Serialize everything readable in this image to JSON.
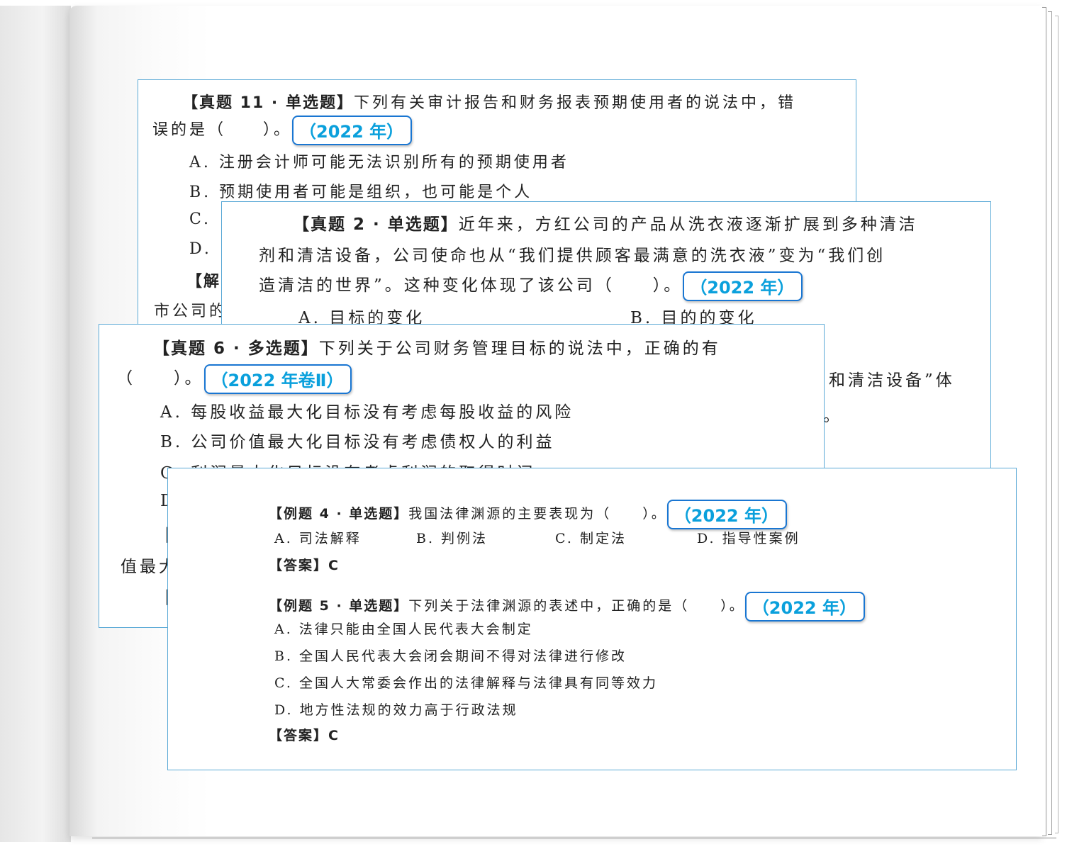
{
  "card1": {
    "question_header": "【真题 11 · 单选题】",
    "question_text_1": "下列有关审计报告和财务报表预期使用者的说法中，错",
    "question_text_2": "误的是（　　）。",
    "year_tag": "（2022 年）",
    "option_a": "A. 注册会计师可能无法识别所有的预期使用者",
    "option_b": "B. 预期使用者可能是组织，也可能是个人",
    "option_c_visible": "C. ",
    "option_d_visible": "D. ",
    "analysis_visible": "【解",
    "partial_line": "市公司的"
  },
  "card2": {
    "question_header": "【真题 2 · 单选题】",
    "question_text_1": "近年来，方红公司的产品从洗衣液逐渐扩展到多种清洁",
    "question_text_2": "剂和清洁设备，公司使命也从“我们提供顾客最满意的洗衣液”变为“我们创",
    "question_text_3": "造清洁的世界”。这种变化体现了该公司（　　）。",
    "year_tag": "（2022 年）",
    "option_a": "A. 目标的变化",
    "option_b": "B. 目的的变化",
    "partial_right_text": "和清洁设备”体",
    "partial_right_mark": "。"
  },
  "card3": {
    "question_header": "【真题 6 · 多选题】",
    "question_text_1": "下列关于公司财务管理目标的说法中，正确的有",
    "question_text_2": "（　　）。",
    "year_tag": "（2022 年卷Ⅱ）",
    "option_a": "A. 每股收益最大化目标没有考虑每股收益的风险",
    "option_b": "B. 公司价值最大化目标没有考虑债权人的利益",
    "option_c_partial": "C. 利润最大化目标没有考虑利润的取得时间",
    "option_d_partial": "D",
    "bracket_partial_1": "【",
    "value_partial": "值最大",
    "bracket_partial_2": "【"
  },
  "card4": {
    "q4_header": "【例题 4 · 单选题】",
    "q4_text": "我国法律渊源的主要表现为（　　）。",
    "q4_year_tag": "（2022 年）",
    "q4_option_a": "A. 司法解释",
    "q4_option_b": "B. 判例法",
    "q4_option_c": "C. 制定法",
    "q4_option_d": "D. 指导性案例",
    "q4_answer": "【答案】C",
    "q5_header": "【例题 5 · 单选题】",
    "q5_text": "下列关于法律渊源的表述中，正确的是（　　）。",
    "q5_year_tag": "（2022 年）",
    "q5_option_a": "A. 法律只能由全国人民代表大会制定",
    "q5_option_b": "B. 全国人民代表大会闭会期间不得对法律进行修改",
    "q5_option_c": "C. 全国人大常委会作出的法律解释与法律具有同等效力",
    "q5_option_d": "D. 地方性法规的效力高于行政法规",
    "q5_answer": "【答案】C"
  },
  "colors": {
    "card_border": "#5aa9d6",
    "tag_border": "#1976d2",
    "tag_text": "#0aa0dc"
  }
}
